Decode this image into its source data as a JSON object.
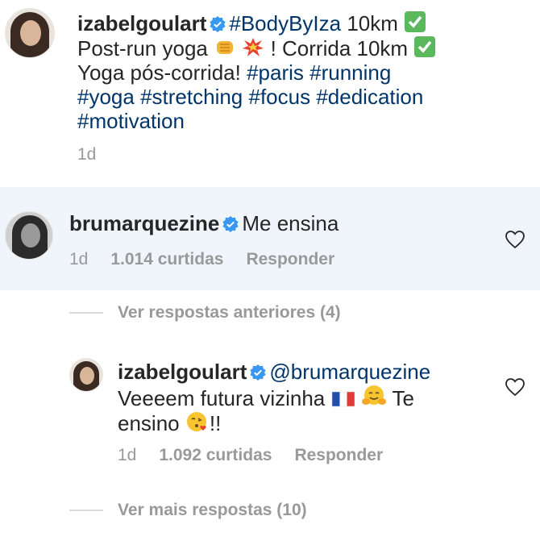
{
  "caption": {
    "username": "izabelgoulart",
    "line1_tag": "#BodyByIza",
    "line1_text": "10km",
    "line2_a": "Post-run yoga",
    "line2_b": "! Corrida 10km",
    "line3_text": "Yoga pós-corrida!",
    "tags_line3": [
      "#paris",
      "#running"
    ],
    "tags_line4": [
      "#yoga",
      "#stretching",
      "#focus",
      "#dedication"
    ],
    "tags_line5": [
      "#motivation"
    ],
    "time": "1d"
  },
  "comment1": {
    "username": "brumarquezine",
    "text": "Me ensina",
    "time": "1d",
    "likes": "1.014 curtidas",
    "reply": "Responder"
  },
  "view_previous": "Ver respostas anteriores (4)",
  "reply1": {
    "username": "izabelgoulart",
    "mention": "@brumarquezine",
    "text_a": "Veeeem futura vizinha",
    "text_b": "Te",
    "text_c": "ensino",
    "text_d": "!!",
    "time": "1d",
    "likes": "1.092 curtidas",
    "reply": "Responder"
  },
  "view_more": "Ver mais respostas (10)",
  "icons": {
    "verified": "verified-badge-icon",
    "check": "check-mark-emoji",
    "fist": "fist-emoji",
    "collision": "collision-emoji",
    "flag": "france-flag-emoji",
    "hug": "hugging-face-emoji",
    "kiss": "kiss-face-emoji",
    "heart": "heart-outline-icon"
  },
  "colors": {
    "hashtag": "#003569",
    "meta": "#999999",
    "highlight": "#eff5fb",
    "verified": "#3897f0"
  }
}
